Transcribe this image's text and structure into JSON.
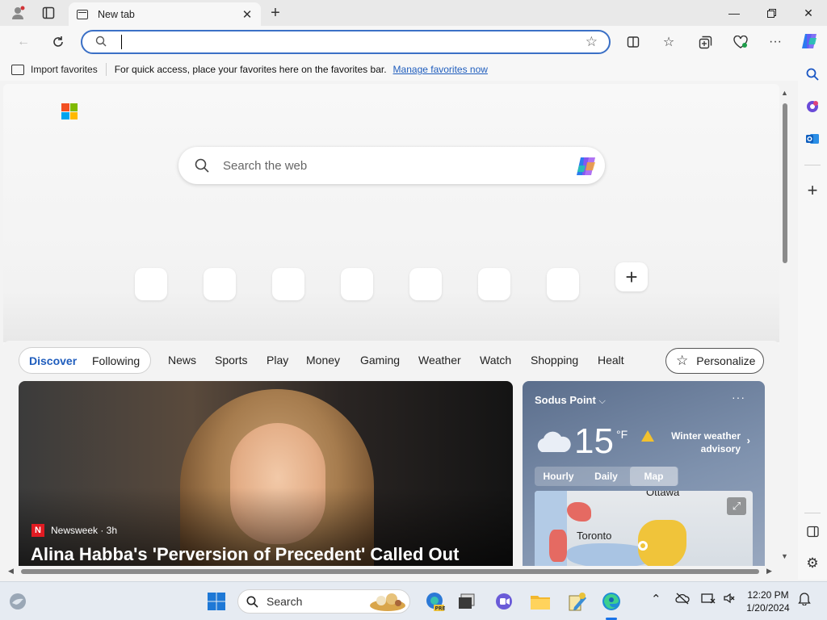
{
  "browser": {
    "tab_title": "New tab",
    "address_value": "",
    "favorites_bar": {
      "import_label": "Import favorites",
      "message": "For quick access, place your favorites here on the favorites bar.",
      "manage_link": "Manage favorites now"
    }
  },
  "ntp": {
    "search_placeholder": "Search the web",
    "add_site_symbol": "+"
  },
  "feed": {
    "tabs": [
      "Discover",
      "Following"
    ],
    "active_tab": "Discover",
    "nav": [
      "News",
      "Sports",
      "Play",
      "Money",
      "Gaming",
      "Weather",
      "Watch",
      "Shopping",
      "Healt"
    ],
    "personalize_label": "Personalize",
    "hero": {
      "source": "Newsweek · 3h",
      "headline": "Alina Habba's 'Perversion of Precedent' Called Out"
    },
    "weather": {
      "location": "Sodus Point",
      "temperature": "15",
      "unit": "°F",
      "advisory_line1": "Winter weather",
      "advisory_line2": "advisory",
      "tabs": [
        "Hourly",
        "Daily",
        "Map"
      ],
      "active_tab": "Map",
      "map_cities": [
        "Ottawa",
        "Toronto"
      ]
    }
  },
  "taskbar": {
    "search_label": "Search",
    "time": "12:20 PM",
    "date": "1/20/2024"
  },
  "colors": {
    "accent": "#3b70c6",
    "link": "#1f5dbd",
    "hero_source_badge": "#e11b22",
    "advisory": "#f2c12e"
  }
}
